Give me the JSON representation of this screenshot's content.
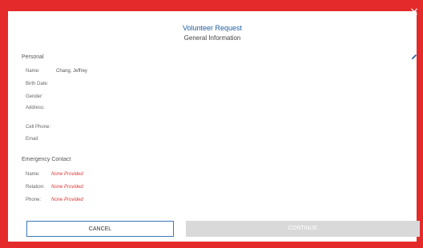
{
  "dialog": {
    "title": "Volunteer Request",
    "subtitle": "General Information",
    "close_glyph": "×"
  },
  "personal": {
    "heading": "Personal",
    "rows": [
      {
        "label": "Name:",
        "value": "Chang, Jeffrey"
      },
      {
        "label": "Birth Date:",
        "value": ""
      },
      {
        "label": "Gender:",
        "value": ""
      },
      {
        "label": "Address:",
        "value": ""
      },
      {
        "label": "Cell Phone:",
        "value": ""
      },
      {
        "label": "Email:",
        "value": ""
      }
    ]
  },
  "emergency": {
    "heading": "Emergency Contact",
    "rows": [
      {
        "label": "Name:",
        "value": "None Provided"
      },
      {
        "label": "Relation:",
        "value": "None Provided"
      },
      {
        "label": "Phone:",
        "value": "None Provided"
      }
    ]
  },
  "buttons": {
    "cancel": "CANCEL",
    "continue": "CONTINUE"
  },
  "colors": {
    "frame": "#e42a2a",
    "title": "#1f5d9c",
    "none_provided": "#d63b3b",
    "disabled_button": "#d9d9d9"
  },
  "icons": {
    "edit": "pencil-icon",
    "close": "close-icon"
  }
}
